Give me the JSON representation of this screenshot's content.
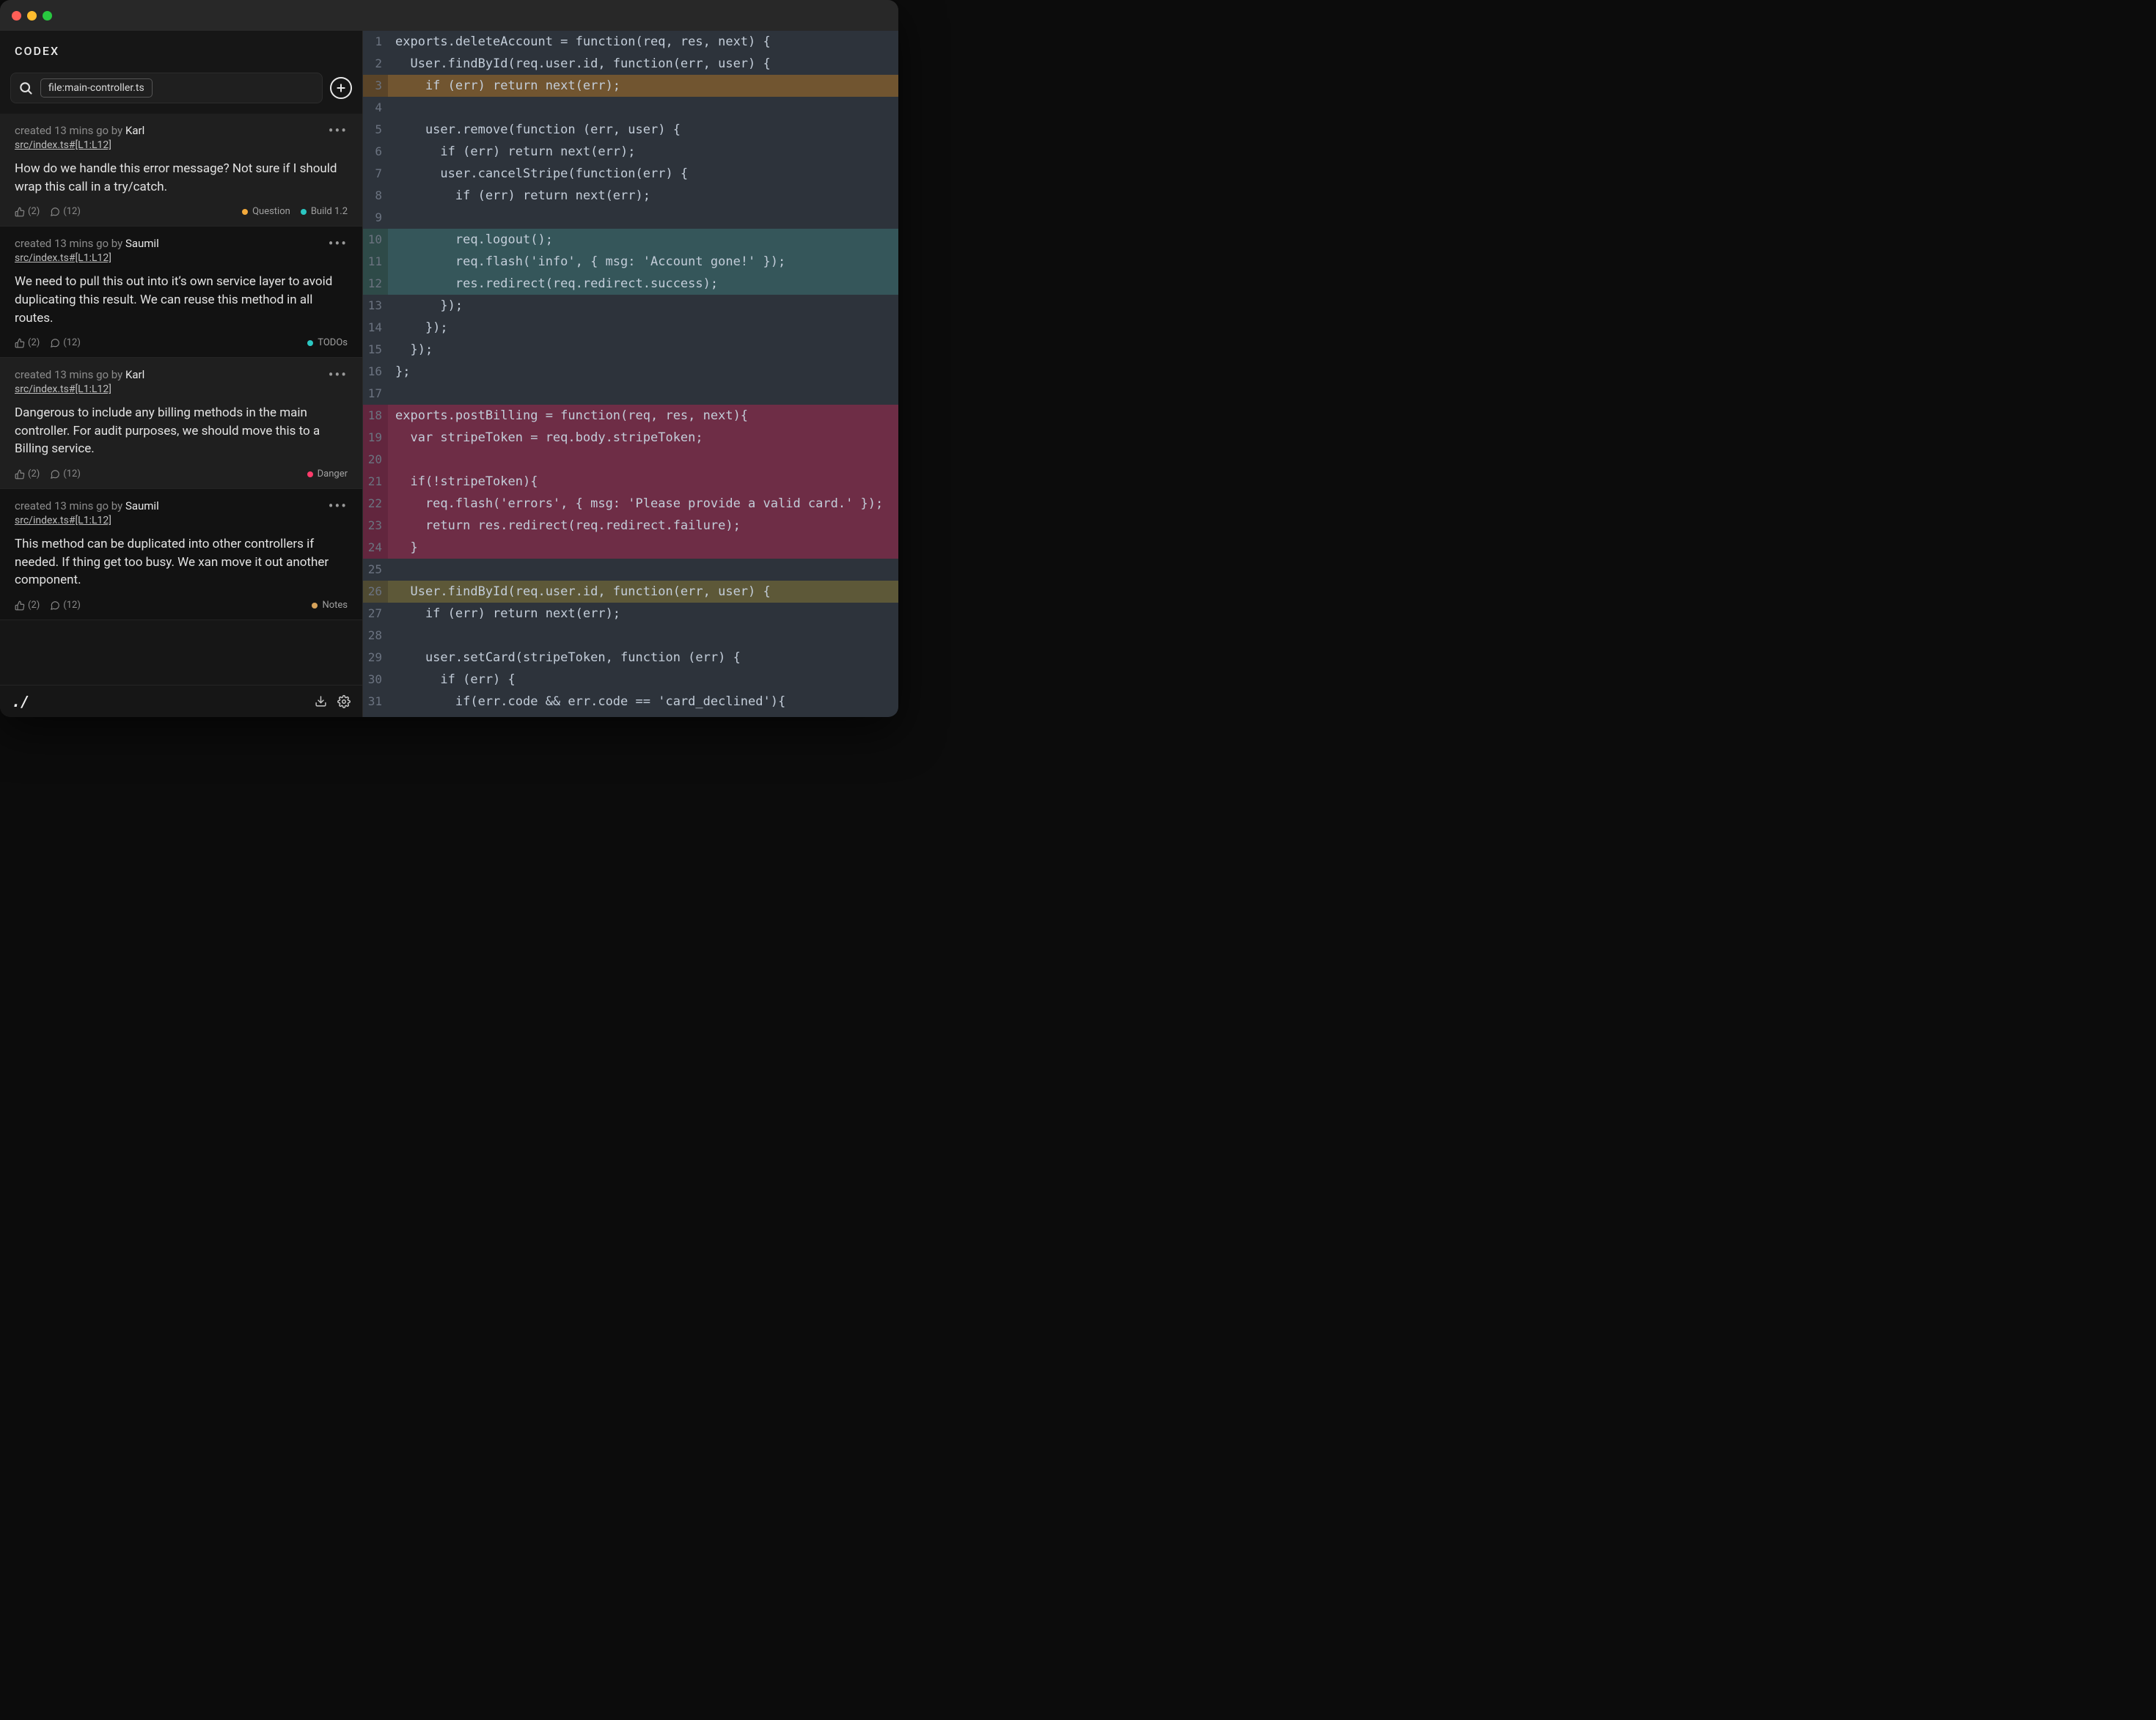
{
  "app": {
    "title": "CODEX"
  },
  "search": {
    "chip": "file:main-controller.ts"
  },
  "tag_colors": {
    "question": "#f2a93b",
    "build": "#2bc7c2",
    "todos": "#2bc7c2",
    "danger": "#ff3b6b",
    "notes": "#d6a25a"
  },
  "cards": [
    {
      "shade": "alt",
      "created": "created 13 mins go by ",
      "author": "Karl",
      "file": "src/index.ts#[L1:L12]",
      "body": "How do we handle this error message? Not sure if I should wrap this call in a try/catch.",
      "likes": "(2)",
      "comments": "(12)",
      "tags": [
        {
          "label": "Question",
          "color_key": "question"
        },
        {
          "label": "Build 1.2",
          "color_key": "build"
        }
      ]
    },
    {
      "shade": "dim",
      "created": "created 13 mins go by ",
      "author": "Saumil",
      "file": "src/index.ts#[L1:L12]",
      "body": "We need to pull this out into it’s own service layer to avoid duplicating this result. We can reuse this method in all routes.",
      "likes": "(2)",
      "comments": "(12)",
      "tags": [
        {
          "label": "TODOs",
          "color_key": "todos"
        }
      ]
    },
    {
      "shade": "alt",
      "created": "created 13 mins go by ",
      "author": "Karl",
      "file": "src/index.ts#[L1:L12]",
      "body": "Dangerous to include any billing methods in the main controller. For audit purposes, we should move this to a Billing service.",
      "likes": "(2)",
      "comments": "(12)",
      "tags": [
        {
          "label": "Danger",
          "color_key": "danger"
        }
      ]
    },
    {
      "shade": "dim",
      "created": "created 13 mins go by ",
      "author": "Saumil",
      "file": "src/index.ts#[L1:L12]",
      "body": "This method can be duplicated into other controllers if needed. If thing get too busy. We xan move it out another component.",
      "likes": "(2)",
      "comments": "(12)",
      "tags": [
        {
          "label": "Notes",
          "color_key": "notes"
        }
      ]
    }
  ],
  "code": {
    "lines": [
      {
        "n": 1,
        "hl": "",
        "text": "exports.deleteAccount = function(req, res, next) {"
      },
      {
        "n": 2,
        "hl": "",
        "text": "  User.findById(req.user.id, function(err, user) {"
      },
      {
        "n": 3,
        "hl": "brown",
        "text": "    if (err) return next(err);"
      },
      {
        "n": 4,
        "hl": "",
        "text": ""
      },
      {
        "n": 5,
        "hl": "",
        "text": "    user.remove(function (err, user) {"
      },
      {
        "n": 6,
        "hl": "",
        "text": "      if (err) return next(err);"
      },
      {
        "n": 7,
        "hl": "",
        "text": "      user.cancelStripe(function(err) {"
      },
      {
        "n": 8,
        "hl": "",
        "text": "        if (err) return next(err);"
      },
      {
        "n": 9,
        "hl": "",
        "text": ""
      },
      {
        "n": 10,
        "hl": "teal",
        "text": "        req.logout();"
      },
      {
        "n": 11,
        "hl": "teal",
        "text": "        req.flash('info', { msg: 'Account gone!' });"
      },
      {
        "n": 12,
        "hl": "teal",
        "text": "        res.redirect(req.redirect.success);"
      },
      {
        "n": 13,
        "hl": "",
        "text": "      });"
      },
      {
        "n": 14,
        "hl": "",
        "text": "    });"
      },
      {
        "n": 15,
        "hl": "",
        "text": "  });"
      },
      {
        "n": 16,
        "hl": "",
        "text": "};"
      },
      {
        "n": 17,
        "hl": "",
        "text": ""
      },
      {
        "n": 18,
        "hl": "magenta",
        "text": "exports.postBilling = function(req, res, next){"
      },
      {
        "n": 19,
        "hl": "magenta",
        "text": "  var stripeToken = req.body.stripeToken;"
      },
      {
        "n": 20,
        "hl": "magenta",
        "text": ""
      },
      {
        "n": 21,
        "hl": "magenta",
        "text": "  if(!stripeToken){"
      },
      {
        "n": 22,
        "hl": "magenta",
        "text": "    req.flash('errors', { msg: 'Please provide a valid card.' });"
      },
      {
        "n": 23,
        "hl": "magenta",
        "text": "    return res.redirect(req.redirect.failure);"
      },
      {
        "n": 24,
        "hl": "magenta",
        "text": "  }"
      },
      {
        "n": 25,
        "hl": "",
        "text": ""
      },
      {
        "n": 26,
        "hl": "olive",
        "text": "  User.findById(req.user.id, function(err, user) {"
      },
      {
        "n": 27,
        "hl": "",
        "text": "    if (err) return next(err);"
      },
      {
        "n": 28,
        "hl": "",
        "text": ""
      },
      {
        "n": 29,
        "hl": "",
        "text": "    user.setCard(stripeToken, function (err) {"
      },
      {
        "n": 30,
        "hl": "",
        "text": "      if (err) {"
      },
      {
        "n": 31,
        "hl": "",
        "text": "        if(err.code && err.code == 'card_declined'){"
      }
    ]
  }
}
